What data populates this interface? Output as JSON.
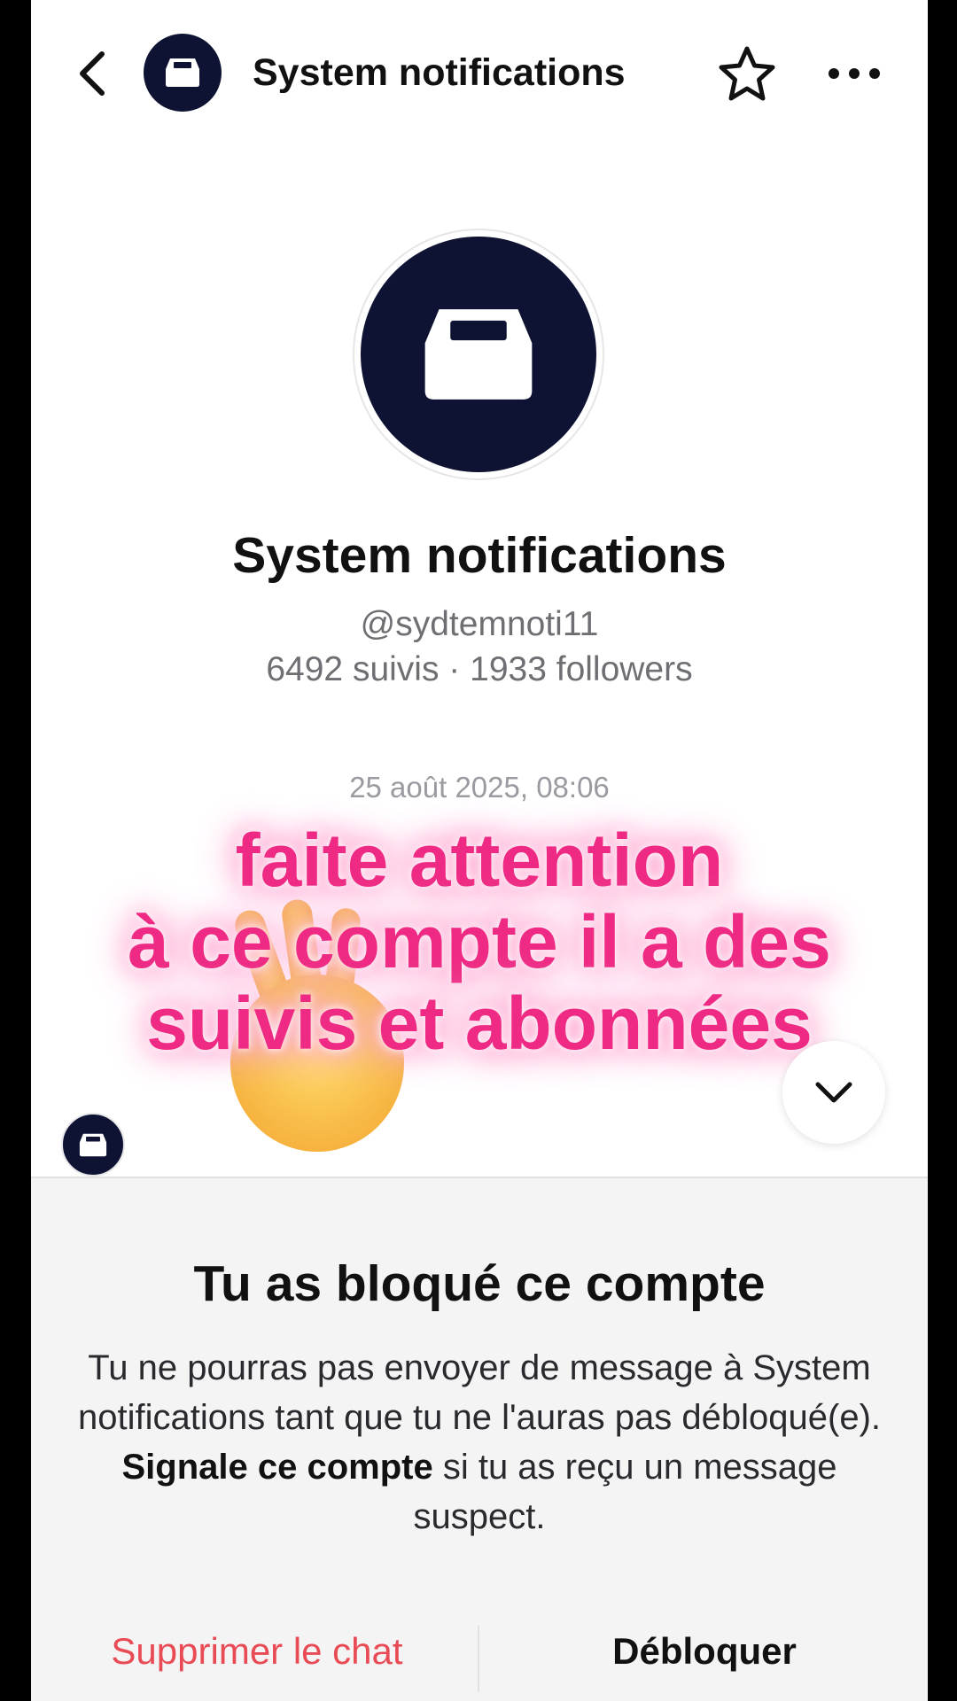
{
  "header": {
    "title": "System notifications",
    "icons": {
      "back": "chevron-left-icon",
      "favorite": "star-outline-icon",
      "more": "more-horizontal-icon"
    }
  },
  "profile": {
    "name": "System notifications",
    "handle": "@sydtemnoti11",
    "stats": "6492 suivis · 1933 followers",
    "avatar_icon": "inbox-tray-icon"
  },
  "chat": {
    "timestamp": "25 août 2025, 08:06"
  },
  "overlay": {
    "line1": "faite attention",
    "line2": "à ce compte il a des",
    "line3": "suivis et abonnées",
    "emoji": "waving-hand-emoji"
  },
  "blocked_panel": {
    "title": "Tu as bloqué ce compte",
    "text_before": "Tu ne pourras pas envoyer de message à System notifications tant que tu ne l'auras pas débloqué(e). ",
    "text_bold": "Signale ce compte",
    "text_after": " si tu as reçu un message suspect.",
    "delete_label": "Supprimer le chat",
    "unblock_label": "Débloquer"
  },
  "colors": {
    "avatar_bg": "#0e1233",
    "overlay_text": "#ee2a84",
    "delete_text": "#e94b55",
    "panel_bg": "#f4f4f5"
  }
}
